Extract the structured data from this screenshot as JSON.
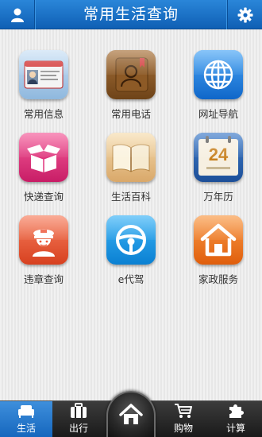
{
  "header": {
    "title": "常用生活查询"
  },
  "apps": [
    {
      "label": "常用信息",
      "icon": "id-card-icon",
      "color": "#9fc4e6"
    },
    {
      "label": "常用电话",
      "icon": "contacts-book-icon",
      "color": "#8a5a2b"
    },
    {
      "label": "网址导航",
      "icon": "globe-icon",
      "color": "#1f7fe0"
    },
    {
      "label": "快递查询",
      "icon": "package-icon",
      "color": "#e0357d"
    },
    {
      "label": "生活百科",
      "icon": "open-book-icon",
      "color": "#e7c28c"
    },
    {
      "label": "万年历",
      "icon": "calendar-icon",
      "color": "#2d67b8",
      "calendar_day": "24"
    },
    {
      "label": "违章查询",
      "icon": "traffic-police-icon",
      "color": "#ee5a3c"
    },
    {
      "label": "e代驾",
      "icon": "steering-wheel-icon",
      "color": "#1a9be6"
    },
    {
      "label": "家政服务",
      "icon": "house-icon",
      "color": "#f0781e"
    }
  ],
  "tabbar": {
    "items": [
      {
        "label": "生活",
        "icon": "sofa-icon",
        "active": true
      },
      {
        "label": "出行",
        "icon": "suitcase-icon",
        "active": false
      },
      {
        "label": "",
        "icon": "home-icon",
        "active": false
      },
      {
        "label": "购物",
        "icon": "shopping-cart-icon",
        "active": false
      },
      {
        "label": "计算",
        "icon": "puzzle-icon",
        "active": false
      }
    ]
  },
  "colors": {
    "header": "#1670c8",
    "active_tab": "#2a7fd0",
    "tabbar": "#2a2a2a"
  }
}
